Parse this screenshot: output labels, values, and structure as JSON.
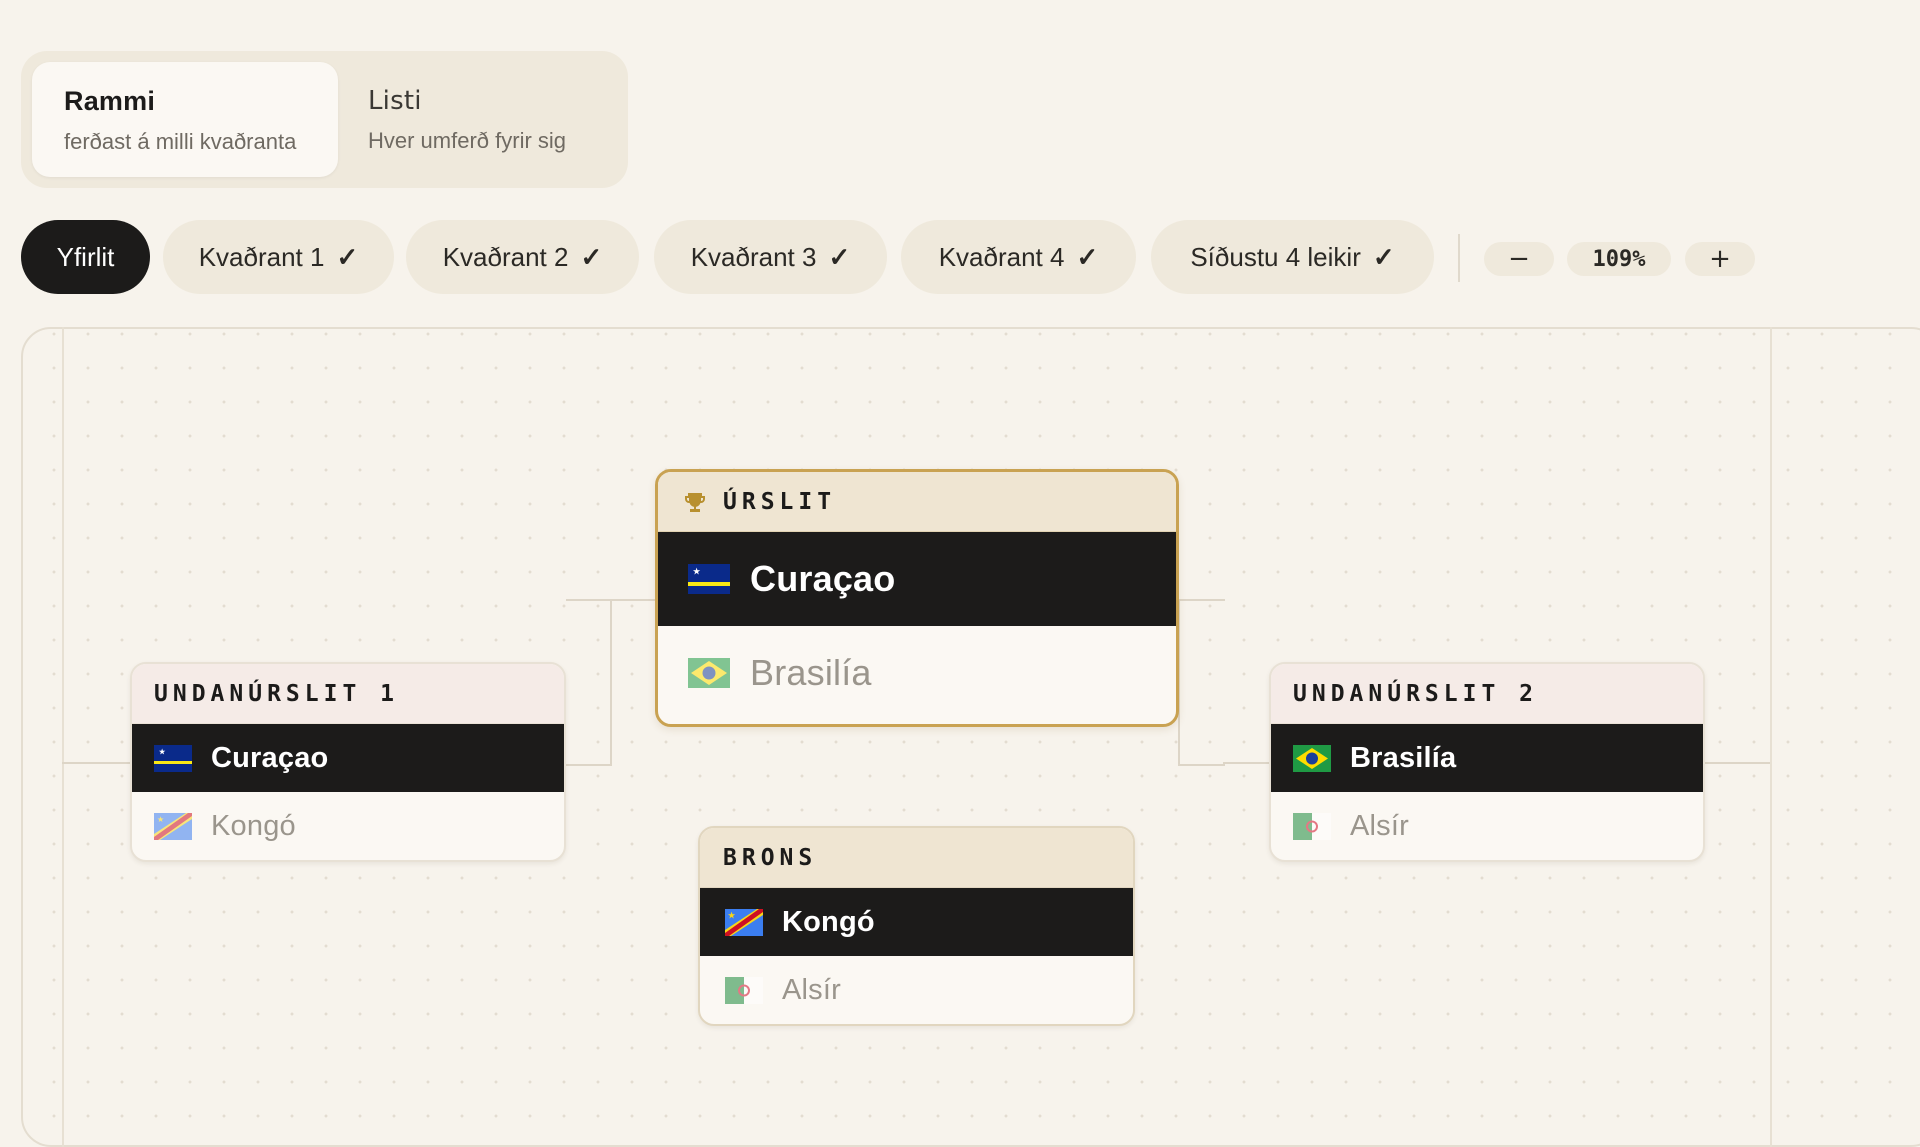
{
  "view_switch": {
    "frame": {
      "title": "Rammi",
      "subtitle": "ferðast á milli kvaðranta"
    },
    "list": {
      "title": "Listi",
      "subtitle": "Hver umferð fyrir sig"
    }
  },
  "tabs": [
    {
      "label": "Yfirlit",
      "active": true,
      "checked": false
    },
    {
      "label": "Kvaðrant 1",
      "active": false,
      "checked": true
    },
    {
      "label": "Kvaðrant 2",
      "active": false,
      "checked": true
    },
    {
      "label": "Kvaðrant 3",
      "active": false,
      "checked": true
    },
    {
      "label": "Kvaðrant 4",
      "active": false,
      "checked": true
    },
    {
      "label": "Síðustu 4 leikir",
      "active": false,
      "checked": true
    }
  ],
  "check_glyph": "✓",
  "zoom": {
    "minus": "−",
    "level": "109%",
    "plus": "+"
  },
  "matches": {
    "semi1": {
      "title": "UNDANÚRSLIT 1",
      "winner": "Curaçao",
      "loser": "Kongó"
    },
    "final": {
      "title": "ÚRSLIT",
      "winner": "Curaçao",
      "loser": "Brasilía"
    },
    "bronze": {
      "title": "BRONS",
      "winner": "Kongó",
      "loser": "Alsír"
    },
    "semi2": {
      "title": "UNDANÚRSLIT 2",
      "winner": "Brasilía",
      "loser": "Alsír"
    }
  },
  "icons": {
    "trophy": "trophy-icon",
    "check": "check-icon",
    "flags": [
      "curacao-flag-icon",
      "brazil-flag-icon",
      "congo-flag-icon",
      "algeria-flag-icon"
    ]
  },
  "colors": {
    "background": "#f7f3ec",
    "winner_row": "#1c1b1a",
    "final_border": "#c9a252",
    "pill": "#efe9dc"
  }
}
